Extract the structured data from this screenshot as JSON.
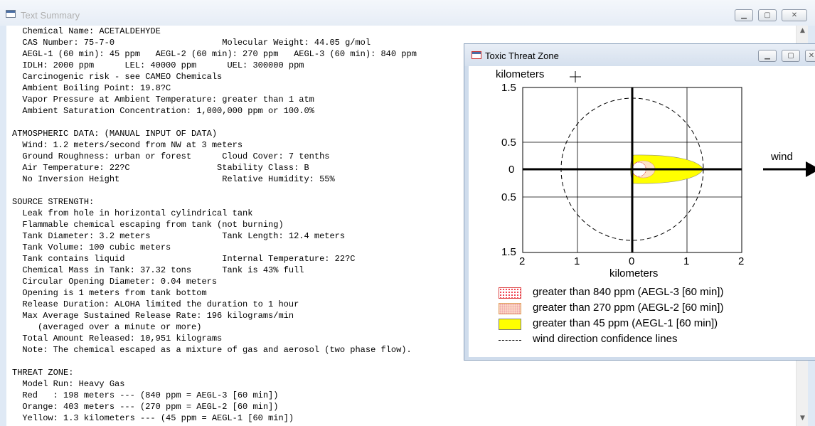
{
  "summary_window": {
    "title": "Text Summary",
    "lines": [
      "  Chemical Name: ACETALDEHYDE",
      "  CAS Number: 75-7-0                     Molecular Weight: 44.05 g/mol",
      "  AEGL-1 (60 min): 45 ppm   AEGL-2 (60 min): 270 ppm   AEGL-3 (60 min): 840 ppm",
      "  IDLH: 2000 ppm      LEL: 40000 ppm      UEL: 300000 ppm",
      "  Carcinogenic risk - see CAMEO Chemicals",
      "  Ambient Boiling Point: 19.8?C",
      "  Vapor Pressure at Ambient Temperature: greater than 1 atm",
      "  Ambient Saturation Concentration: 1,000,000 ppm or 100.0%",
      "",
      "ATMOSPHERIC DATA: (MANUAL INPUT OF DATA)",
      "  Wind: 1.2 meters/second from NW at 3 meters",
      "  Ground Roughness: urban or forest      Cloud Cover: 7 tenths",
      "  Air Temperature: 22?C                 Stability Class: B",
      "  No Inversion Height                    Relative Humidity: 55%",
      "",
      "SOURCE STRENGTH:",
      "  Leak from hole in horizontal cylindrical tank",
      "  Flammable chemical escaping from tank (not burning)",
      "  Tank Diameter: 3.2 meters              Tank Length: 12.4 meters",
      "  Tank Volume: 100 cubic meters",
      "  Tank contains liquid                   Internal Temperature: 22?C",
      "  Chemical Mass in Tank: 37.32 tons      Tank is 43% full",
      "  Circular Opening Diameter: 0.04 meters",
      "  Opening is 1 meters from tank bottom",
      "  Release Duration: ALOHA limited the duration to 1 hour",
      "  Max Average Sustained Release Rate: 196 kilograms/min",
      "     (averaged over a minute or more)",
      "  Total Amount Released: 10,951 kilograms",
      "  Note: The chemical escaped as a mixture of gas and aerosol (two phase flow).",
      "",
      "THREAT ZONE:",
      "  Model Run: Heavy Gas",
      "  Red   : 198 meters --- (840 ppm = AEGL-3 [60 min])",
      "  Orange: 403 meters --- (270 ppm = AEGL-2 [60 min])",
      "  Yellow: 1.3 kilometers --- (45 ppm = AEGL-1 [60 min])"
    ]
  },
  "threat_window": {
    "title": "Toxic Threat Zone",
    "y_axis_label": "kilometers",
    "x_axis_label": "kilometers",
    "x_ticks": [
      "2",
      "1",
      "0",
      "1",
      "2"
    ],
    "y_ticks": [
      "1.5",
      "0.5",
      "0",
      "0.5",
      "1.5"
    ],
    "wind_label": "wind",
    "legend": [
      {
        "swatch": "red-dotted",
        "label": "greater than 840 ppm (AEGL-3 [60 min])"
      },
      {
        "swatch": "orange-dotted",
        "label": "greater than 270 ppm (AEGL-2 [60 min])"
      },
      {
        "swatch": "yellow",
        "label": "greater than 45 ppm (AEGL-1 [60 min])"
      },
      {
        "swatch": "dashed-line",
        "label": "wind direction confidence lines"
      }
    ],
    "zones_km": {
      "red": 0.198,
      "orange": 0.403,
      "yellow": 1.3
    },
    "colors": {
      "red": "#e03030",
      "orange": "#f4b183",
      "yellow": "#ffff00"
    }
  },
  "icons": {
    "cursor": "crosshair-cursor-icon",
    "wind_arrow": "arrow-right-icon"
  }
}
